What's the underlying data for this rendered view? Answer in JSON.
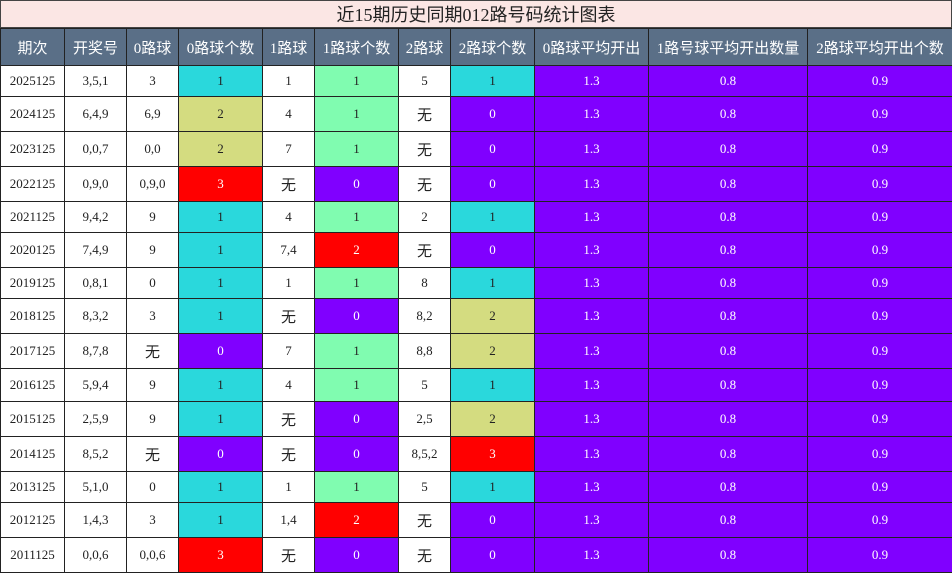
{
  "title": "近15期历史同期012路号码统计图表",
  "headers": [
    "期次",
    "开奖号",
    "0路球",
    "0路球个数",
    "1路球",
    "1路球个数",
    "2路球",
    "2路球个数",
    "0路球平均开出",
    "1路号球平均开出数量",
    "2路球平均开出个数"
  ],
  "avg": {
    "zero": "1.3",
    "one": "0.8",
    "two": "0.9"
  },
  "rows": [
    {
      "period": "2025125",
      "draw": "3,5,1",
      "r0": "3",
      "c0": "1",
      "r1": "1",
      "c1": "1",
      "r2": "5",
      "c2": "1"
    },
    {
      "period": "2024125",
      "draw": "6,4,9",
      "r0": "6,9",
      "c0": "2",
      "r1": "4",
      "c1": "1",
      "r2": "无",
      "c2": "0"
    },
    {
      "period": "2023125",
      "draw": "0,0,7",
      "r0": "0,0",
      "c0": "2",
      "r1": "7",
      "c1": "1",
      "r2": "无",
      "c2": "0"
    },
    {
      "period": "2022125",
      "draw": "0,9,0",
      "r0": "0,9,0",
      "c0": "3",
      "r1": "无",
      "c1": "0",
      "r2": "无",
      "c2": "0"
    },
    {
      "period": "2021125",
      "draw": "9,4,2",
      "r0": "9",
      "c0": "1",
      "r1": "4",
      "c1": "1",
      "r2": "2",
      "c2": "1"
    },
    {
      "period": "2020125",
      "draw": "7,4,9",
      "r0": "9",
      "c0": "1",
      "r1": "7,4",
      "c1": "2",
      "r2": "无",
      "c2": "0"
    },
    {
      "period": "2019125",
      "draw": "0,8,1",
      "r0": "0",
      "c0": "1",
      "r1": "1",
      "c1": "1",
      "r2": "8",
      "c2": "1"
    },
    {
      "period": "2018125",
      "draw": "8,3,2",
      "r0": "3",
      "c0": "1",
      "r1": "无",
      "c1": "0",
      "r2": "8,2",
      "c2": "2"
    },
    {
      "period": "2017125",
      "draw": "8,7,8",
      "r0": "无",
      "c0": "0",
      "r1": "7",
      "c1": "1",
      "r2": "8,8",
      "c2": "2"
    },
    {
      "period": "2016125",
      "draw": "5,9,4",
      "r0": "9",
      "c0": "1",
      "r1": "4",
      "c1": "1",
      "r2": "5",
      "c2": "1"
    },
    {
      "period": "2015125",
      "draw": "2,5,9",
      "r0": "9",
      "c0": "1",
      "r1": "无",
      "c1": "0",
      "r2": "2,5",
      "c2": "2"
    },
    {
      "period": "2014125",
      "draw": "8,5,2",
      "r0": "无",
      "c0": "0",
      "r1": "无",
      "c1": "0",
      "r2": "8,5,2",
      "c2": "3"
    },
    {
      "period": "2013125",
      "draw": "5,1,0",
      "r0": "0",
      "c0": "1",
      "r1": "1",
      "c1": "1",
      "r2": "5",
      "c2": "1"
    },
    {
      "period": "2012125",
      "draw": "1,4,3",
      "r0": "3",
      "c0": "1",
      "r1": "1,4",
      "c1": "2",
      "r2": "无",
      "c2": "0"
    },
    {
      "period": "2011125",
      "draw": "0,0,6",
      "r0": "0,0,6",
      "c0": "3",
      "r1": "无",
      "c1": "0",
      "r2": "无",
      "c2": "0"
    }
  ],
  "colors": {
    "header_bg": "#5a6f87",
    "title_bg": "#fbe6e4",
    "count0": {
      "0": "#8000ff",
      "1": "#2ad8dc",
      "2": "#d4dc80",
      "3": "#ff0000"
    },
    "count1": {
      "0": "#8000ff",
      "1": "#80fcb0",
      "2": "#ff0000"
    },
    "count2": {
      "0": "#8000ff",
      "1": "#2ad8dc",
      "2": "#d4dc80",
      "3": "#ff0000"
    },
    "avg_bg": "#8000ff"
  }
}
